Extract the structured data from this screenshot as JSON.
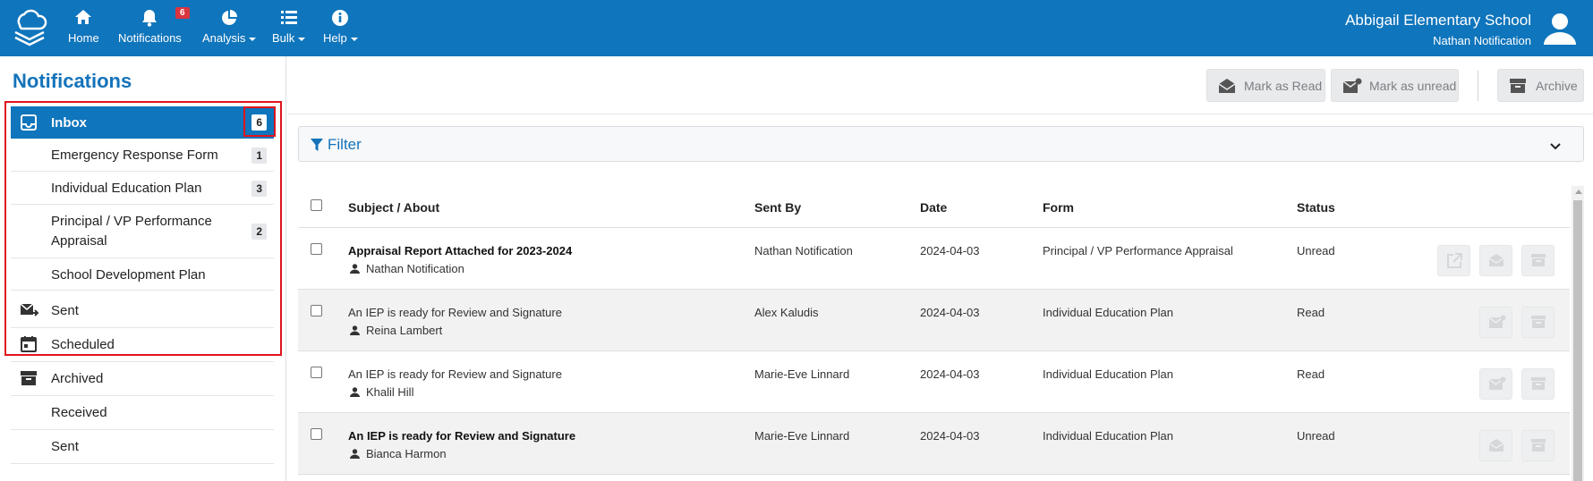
{
  "header": {
    "nav": [
      {
        "label": "Home",
        "icon": "home-icon",
        "dropdown": false
      },
      {
        "label": "Notifications",
        "icon": "bell-icon",
        "dropdown": false,
        "badge": "6"
      },
      {
        "label": "Analysis",
        "icon": "pie-chart-icon",
        "dropdown": true
      },
      {
        "label": "Bulk",
        "icon": "list-icon",
        "dropdown": true
      },
      {
        "label": "Help",
        "icon": "info-icon",
        "dropdown": true
      }
    ],
    "school_name": "Abbigail Elementary School",
    "user_name": "Nathan Notification"
  },
  "sidebar": {
    "title": "Notifications",
    "inbox": {
      "label": "Inbox",
      "count": "6"
    },
    "inbox_items": [
      {
        "label": "Emergency Response Form",
        "count": "1"
      },
      {
        "label": "Individual Education Plan",
        "count": "3"
      },
      {
        "label": "Principal / VP Performance Appraisal",
        "count": "2"
      },
      {
        "label": "School Development Plan",
        "count": ""
      }
    ],
    "items": [
      {
        "label": "Sent",
        "icon": "send-mail-icon"
      },
      {
        "label": "Scheduled",
        "icon": "calendar-icon"
      },
      {
        "label": "Archived",
        "icon": "archive-icon"
      },
      {
        "label": "Received",
        "icon": ""
      },
      {
        "label": "Sent",
        "icon": ""
      }
    ]
  },
  "toolbar": {
    "mark_read": "Mark as Read",
    "mark_unread": "Mark as unread",
    "archive": "Archive"
  },
  "filter": {
    "label": "Filter"
  },
  "table": {
    "columns": [
      "Subject / About",
      "Sent By",
      "Date",
      "Form",
      "Status"
    ],
    "rows": [
      {
        "subject": "Appraisal Report Attached for 2023-2024",
        "about": "Nathan Notification",
        "sent_by": "Nathan Notification",
        "date": "2024-04-03",
        "form": "Principal / VP Performance Appraisal",
        "status": "Unread",
        "bold": true
      },
      {
        "subject": "An IEP is ready for Review and Signature",
        "about": "Reina Lambert",
        "sent_by": "Alex Kaludis",
        "date": "2024-04-03",
        "form": "Individual Education Plan",
        "status": "Read",
        "bold": false
      },
      {
        "subject": "An IEP is ready for Review and Signature",
        "about": "Khalil Hill",
        "sent_by": "Marie-Eve Linnard",
        "date": "2024-04-03",
        "form": "Individual Education Plan",
        "status": "Read",
        "bold": false
      },
      {
        "subject": "An IEP is ready for Review and Signature",
        "about": "Bianca Harmon",
        "sent_by": "Marie-Eve Linnard",
        "date": "2024-04-03",
        "form": "Individual Education Plan",
        "status": "Unread",
        "bold": true
      }
    ]
  },
  "colors": {
    "brand": "#0f75bc",
    "title": "#1473ba",
    "badge": "#d9343f",
    "highlight": "#e0141e"
  }
}
